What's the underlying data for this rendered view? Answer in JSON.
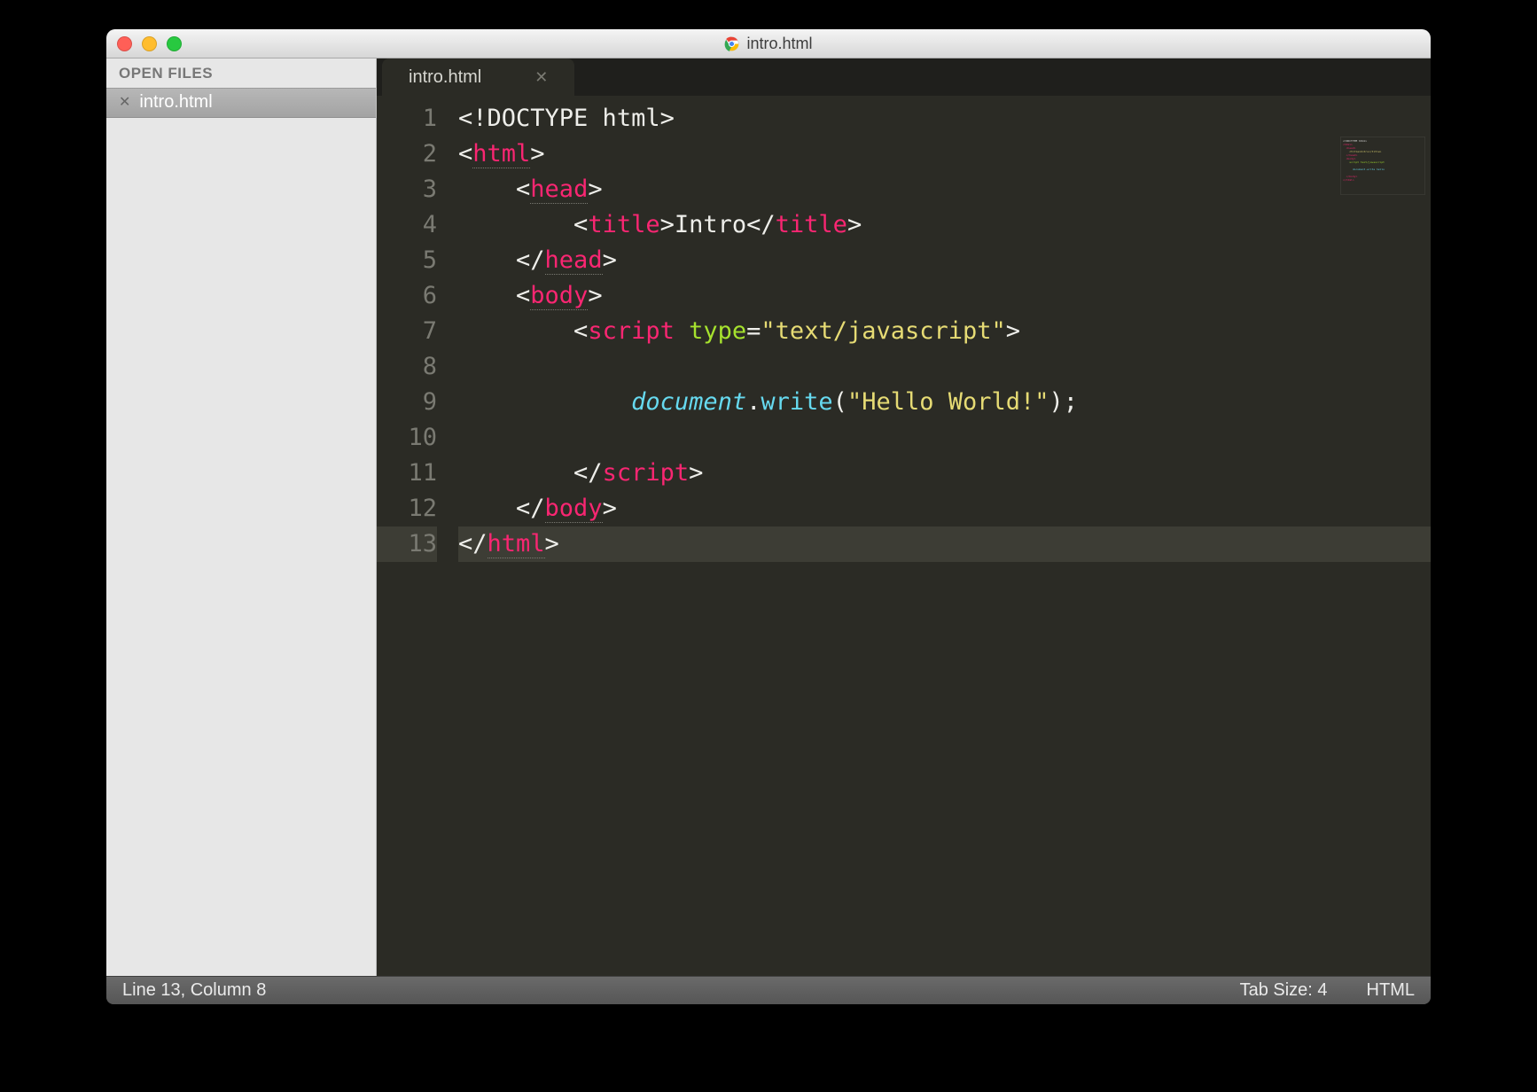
{
  "window": {
    "title": "intro.html"
  },
  "sidebar": {
    "header": "OPEN FILES",
    "items": [
      {
        "label": "intro.html"
      }
    ]
  },
  "tabs": [
    {
      "label": "intro.html"
    }
  ],
  "editor": {
    "line_numbers": [
      "1",
      "2",
      "3",
      "4",
      "5",
      "6",
      "7",
      "8",
      "9",
      "10",
      "11",
      "12",
      "13"
    ],
    "current_line_index": 12,
    "code_lines": [
      [
        {
          "c": "t-punct",
          "t": "<!"
        },
        {
          "c": "t-text",
          "t": "DOCTYPE html"
        },
        {
          "c": "t-punct",
          "t": ">"
        }
      ],
      [
        {
          "c": "t-punct",
          "t": "<"
        },
        {
          "c": "t-tag t-name",
          "t": "html"
        },
        {
          "c": "t-punct",
          "t": ">"
        }
      ],
      [
        {
          "c": "",
          "t": "    "
        },
        {
          "c": "t-punct",
          "t": "<"
        },
        {
          "c": "t-tag t-name",
          "t": "head"
        },
        {
          "c": "t-punct",
          "t": ">"
        }
      ],
      [
        {
          "c": "",
          "t": "        "
        },
        {
          "c": "t-punct",
          "t": "<"
        },
        {
          "c": "t-tag",
          "t": "title"
        },
        {
          "c": "t-punct",
          "t": ">"
        },
        {
          "c": "t-text",
          "t": "Intro"
        },
        {
          "c": "t-punct",
          "t": "</"
        },
        {
          "c": "t-tag",
          "t": "title"
        },
        {
          "c": "t-punct",
          "t": ">"
        }
      ],
      [
        {
          "c": "",
          "t": "    "
        },
        {
          "c": "t-punct",
          "t": "</"
        },
        {
          "c": "t-tag t-name",
          "t": "head"
        },
        {
          "c": "t-punct",
          "t": ">"
        }
      ],
      [
        {
          "c": "",
          "t": "    "
        },
        {
          "c": "t-punct",
          "t": "<"
        },
        {
          "c": "t-tag t-name",
          "t": "body"
        },
        {
          "c": "t-punct",
          "t": ">"
        }
      ],
      [
        {
          "c": "",
          "t": "        "
        },
        {
          "c": "t-punct",
          "t": "<"
        },
        {
          "c": "t-tag",
          "t": "script"
        },
        {
          "c": "",
          "t": " "
        },
        {
          "c": "t-attr",
          "t": "type"
        },
        {
          "c": "t-punct",
          "t": "="
        },
        {
          "c": "t-str",
          "t": "\"text/javascript\""
        },
        {
          "c": "t-punct",
          "t": ">"
        }
      ],
      [
        {
          "c": "",
          "t": ""
        }
      ],
      [
        {
          "c": "",
          "t": "            "
        },
        {
          "c": "t-obj",
          "t": "document"
        },
        {
          "c": "t-punct",
          "t": "."
        },
        {
          "c": "t-func",
          "t": "write"
        },
        {
          "c": "t-punct",
          "t": "("
        },
        {
          "c": "t-str",
          "t": "\"Hello World!\""
        },
        {
          "c": "t-punct",
          "t": ");"
        }
      ],
      [
        {
          "c": "",
          "t": ""
        }
      ],
      [
        {
          "c": "",
          "t": "        "
        },
        {
          "c": "t-punct",
          "t": "</"
        },
        {
          "c": "t-tag",
          "t": "script"
        },
        {
          "c": "t-punct",
          "t": ">"
        }
      ],
      [
        {
          "c": "",
          "t": "    "
        },
        {
          "c": "t-punct",
          "t": "</"
        },
        {
          "c": "t-tag t-name",
          "t": "body"
        },
        {
          "c": "t-punct",
          "t": ">"
        }
      ],
      [
        {
          "c": "t-punct",
          "t": "</"
        },
        {
          "c": "t-tag t-name",
          "t": "html"
        },
        {
          "c": "t-punct",
          "t": ">"
        }
      ]
    ]
  },
  "status": {
    "position": "Line 13, Column 8",
    "tab_size": "Tab Size: 4",
    "syntax": "HTML"
  }
}
